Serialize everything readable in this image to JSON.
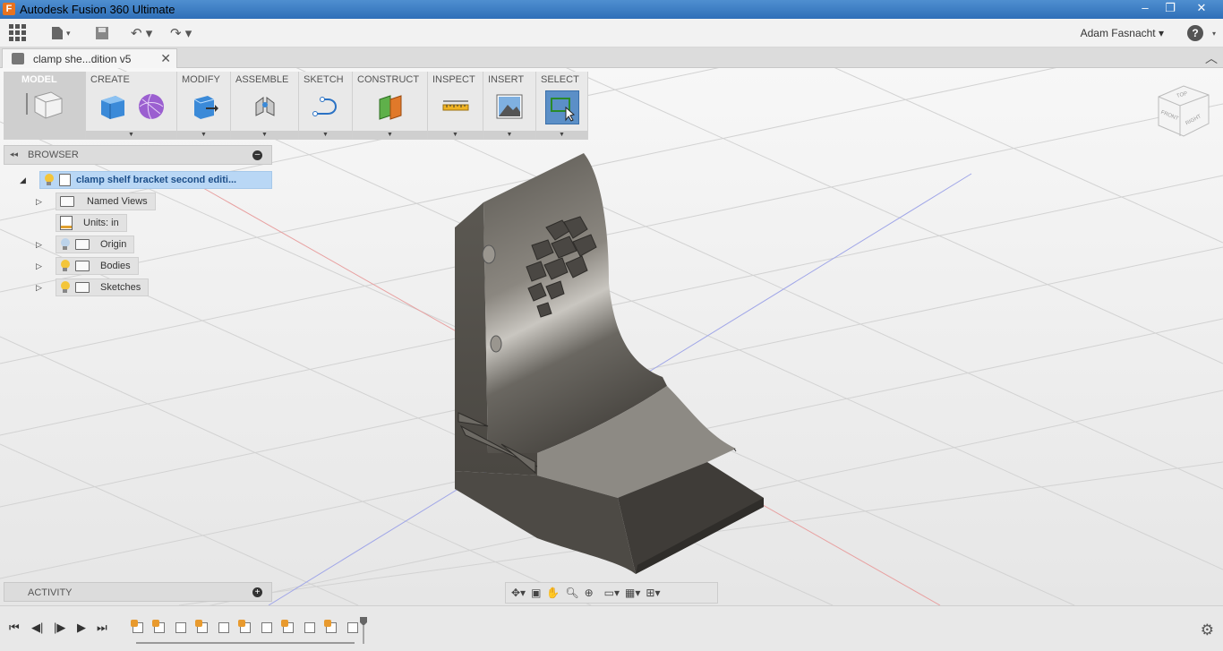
{
  "window": {
    "title": "Autodesk Fusion 360 Ultimate",
    "app_icon": "F",
    "min": "–",
    "max": "❐",
    "close": "✕"
  },
  "appbar": {
    "user": "Adam Fasnacht ▾",
    "help": "?",
    "undo": "↶ ▾",
    "redo": "↷ ▾",
    "file": "▾"
  },
  "tab": {
    "label": "clamp she...dition v5",
    "close": "✕",
    "collapse": "︿"
  },
  "toolbar": {
    "groups": [
      {
        "label": "MODEL"
      },
      {
        "label": "CREATE"
      },
      {
        "label": "MODIFY"
      },
      {
        "label": "ASSEMBLE"
      },
      {
        "label": "SKETCH"
      },
      {
        "label": "CONSTRUCT"
      },
      {
        "label": "INSPECT"
      },
      {
        "label": "INSERT"
      },
      {
        "label": "SELECT"
      }
    ]
  },
  "browser": {
    "title": "BROWSER",
    "arrows": "◂◂",
    "root": "clamp shelf bracket second editi...",
    "items": [
      "Named Views",
      "Units: in",
      "Origin",
      "Bodies",
      "Sketches"
    ]
  },
  "activity": {
    "title": "ACTIVITY"
  },
  "viewcube": {
    "top": "TOP",
    "front": "FRONT",
    "right": "RIGHT"
  },
  "colors": {
    "accent": "#2f6fb8",
    "selection": "#b9d7f5",
    "model_metal": "#6e6b66"
  }
}
